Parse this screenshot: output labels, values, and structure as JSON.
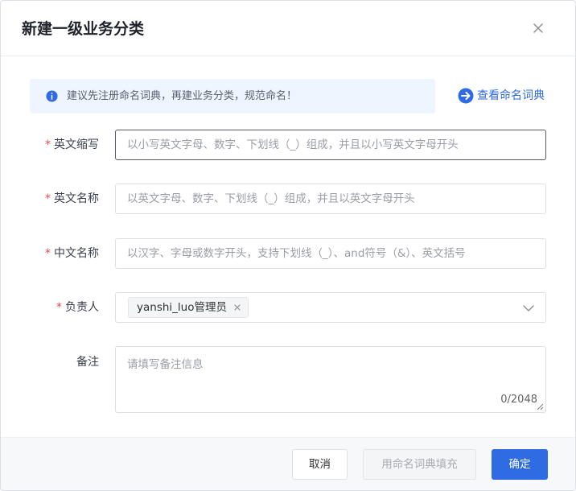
{
  "dialog": {
    "title": "新建一级业务分类",
    "close_icon": "close-icon"
  },
  "tip": {
    "icon": "info-icon",
    "text": "建议先注册命名词典，再建业务分类，规范命名！",
    "link_icon": "arrow-right-circle-icon",
    "link_label": "查看命名词典"
  },
  "form": {
    "required_mark": "*",
    "english_abbr": {
      "label": "英文缩写",
      "required": true,
      "value": "",
      "placeholder": "以小写英文字母、数字、下划线（_）组成，并且以小写英文字母开头"
    },
    "english_name": {
      "label": "英文名称",
      "required": true,
      "value": "",
      "placeholder": "以英文字母、数字、下划线（_）组成，并且以英文字母开头"
    },
    "chinese_name": {
      "label": "中文名称",
      "required": true,
      "value": "",
      "placeholder": "以汉字、字母或数字开头，支持下划线（_）、and符号（&）、英文括号"
    },
    "owner": {
      "label": "负责人",
      "required": true,
      "selected_tags": [
        "yanshi_luo管理员"
      ],
      "tag_close_icon": "close-icon",
      "arrow_icon": "chevron-down-icon"
    },
    "remark": {
      "label": "备注",
      "required": false,
      "value": "",
      "placeholder": "请填写备注信息",
      "counter": "0/2048"
    }
  },
  "footer": {
    "cancel_label": "取消",
    "fill_from_dict_label": "用命名词典填充",
    "confirm_label": "确定"
  },
  "colors": {
    "primary": "#2f6be3",
    "required": "#f04a4a",
    "tip_background": "#eef5fe",
    "footer_background": "#f7f8fa"
  }
}
